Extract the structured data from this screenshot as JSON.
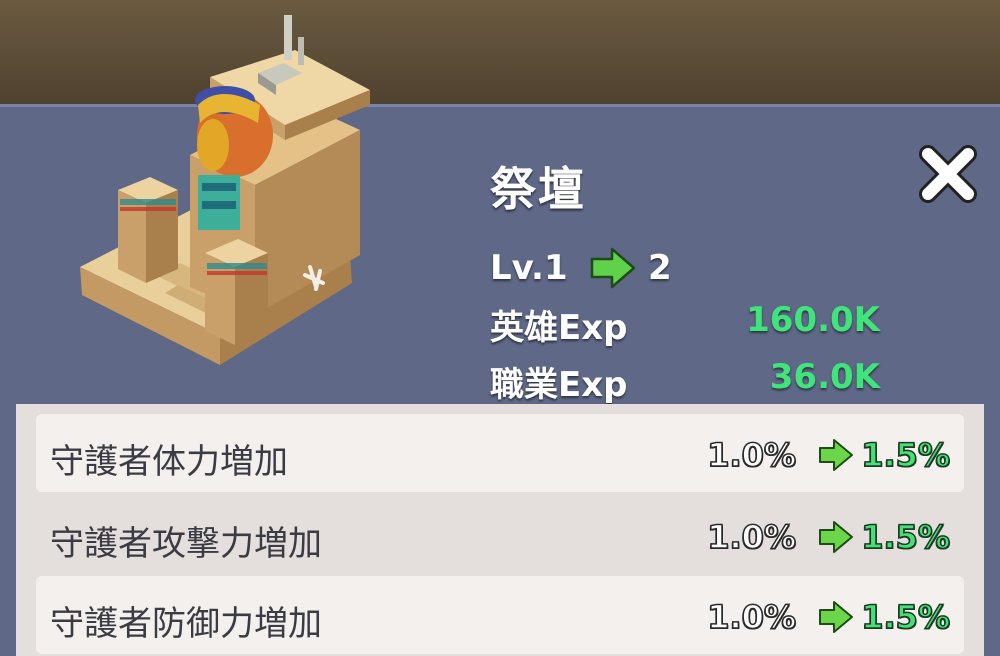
{
  "building": {
    "name": "祭壇",
    "icon": "sphinx-altar-building-icon"
  },
  "level": {
    "from": "Lv.1",
    "to": "2"
  },
  "exp": [
    {
      "label": "英雄Exp",
      "value": "160.0K"
    },
    {
      "label": "職業Exp",
      "value": "36.0K"
    }
  ],
  "bonuses": [
    {
      "label": "守護者体力増加",
      "from": "1.0%",
      "to": "1.5%"
    },
    {
      "label": "守護者攻撃力増加",
      "from": "1.0%",
      "to": "1.5%"
    },
    {
      "label": "守護者防御力増加",
      "from": "1.0%",
      "to": "1.5%"
    }
  ],
  "colors": {
    "panel": "#5f6887",
    "accent_green": "#44e274",
    "list_bg": "#e4dedc"
  }
}
